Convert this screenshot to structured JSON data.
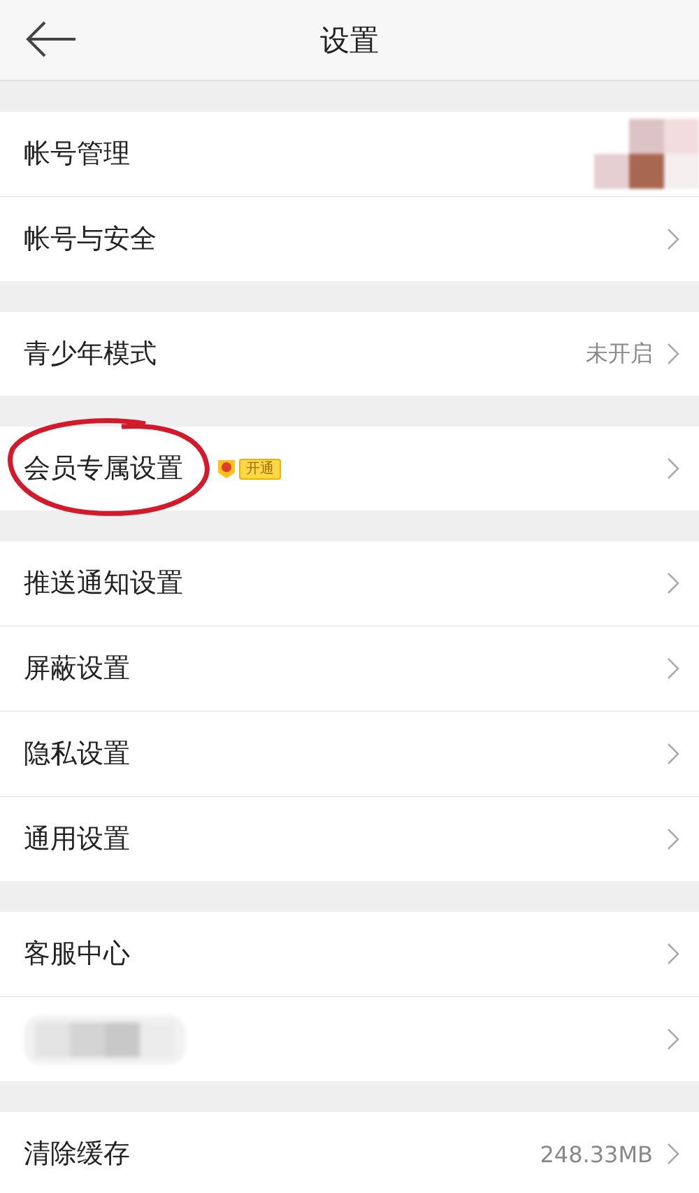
{
  "header": {
    "title": "设置"
  },
  "groups": [
    {
      "rows": [
        {
          "kind": "avatar",
          "label": "帐号管理"
        },
        {
          "kind": "link",
          "label": "帐号与安全"
        }
      ]
    },
    {
      "rows": [
        {
          "kind": "link",
          "label": "青少年模式",
          "value": "未开启"
        }
      ]
    },
    {
      "rows": [
        {
          "kind": "link",
          "label": "会员专属设置",
          "badge": "开通",
          "annotated": true
        }
      ]
    },
    {
      "rows": [
        {
          "kind": "link",
          "label": "推送通知设置"
        },
        {
          "kind": "link",
          "label": "屏蔽设置"
        },
        {
          "kind": "link",
          "label": "隐私设置"
        },
        {
          "kind": "link",
          "label": "通用设置"
        }
      ]
    },
    {
      "rows": [
        {
          "kind": "link",
          "label": "客服中心"
        },
        {
          "kind": "blurred"
        }
      ]
    },
    {
      "rows": [
        {
          "kind": "link",
          "label": "清除缓存",
          "value": "248.33MB"
        }
      ]
    }
  ]
}
